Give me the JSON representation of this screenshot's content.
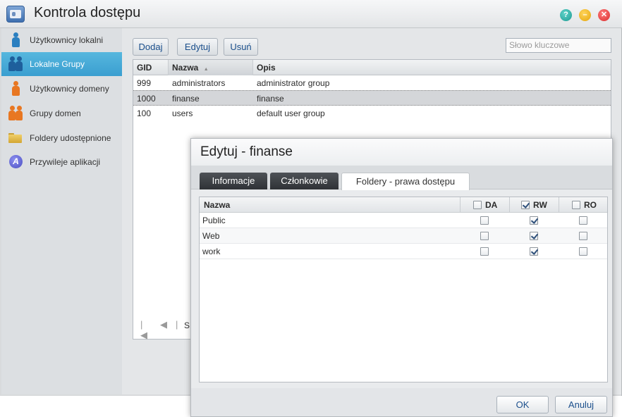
{
  "app": {
    "title": "Kontrola dostępu",
    "help_glyph": "?",
    "min_glyph": "–",
    "close_glyph": "✕"
  },
  "sidebar": {
    "items": [
      {
        "label": "Użytkownicy lokalni",
        "icon": "user-icon",
        "active": false
      },
      {
        "label": "Lokalne Grupy",
        "icon": "group-icon",
        "active": true
      },
      {
        "label": "Użytkownicy domeny",
        "icon": "domain-user-icon",
        "active": false
      },
      {
        "label": "Grupy domen",
        "icon": "domain-group-icon",
        "active": false
      },
      {
        "label": "Foldery udostępnione",
        "icon": "shared-folder-icon",
        "active": false
      },
      {
        "label": "Przywileje aplikacji",
        "icon": "app-privilege-icon",
        "active": false
      }
    ]
  },
  "toolbar": {
    "add": "Dodaj",
    "edit": "Edytuj",
    "delete": "Usuń",
    "search_placeholder": "Słowo kluczowe"
  },
  "groups_table": {
    "columns": [
      "GID",
      "Nazwa",
      "Opis"
    ],
    "sort_indicator": "▲",
    "rows": [
      {
        "gid": "999",
        "name": "administrators",
        "desc": "administrator group"
      },
      {
        "gid": "1000",
        "name": "finanse",
        "desc": "finanse"
      },
      {
        "gid": "100",
        "name": "users",
        "desc": "default user group"
      }
    ],
    "selected_row": 1,
    "pager_text": "S"
  },
  "dialog": {
    "title": "Edytuj - finanse",
    "tabs": [
      "Informacje",
      "Członkowie",
      "Foldery - prawa dostępu"
    ],
    "active_tab": 2,
    "perm_columns": {
      "name": "Nazwa",
      "da": "DA",
      "rw": "RW",
      "ro": "RO"
    },
    "perm_header_checks": {
      "da": false,
      "rw": true,
      "ro": false
    },
    "folders": [
      {
        "name": "Public",
        "da": false,
        "rw": true,
        "ro": false
      },
      {
        "name": "Web",
        "da": false,
        "rw": true,
        "ro": false
      },
      {
        "name": "work",
        "da": false,
        "rw": true,
        "ro": false
      }
    ],
    "ok": "OK",
    "cancel": "Anuluj"
  },
  "colors": {
    "accent": "#3a9ed0",
    "button_text": "#1b4f8c"
  }
}
